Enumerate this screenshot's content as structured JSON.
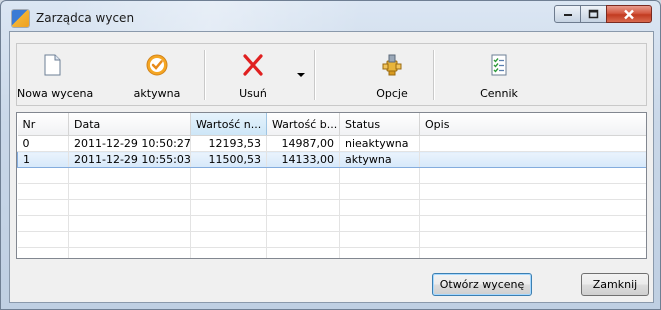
{
  "window": {
    "title": "Zarządca wycen"
  },
  "toolbar": {
    "new_label": "Nowa wycena",
    "active_label": "aktywna",
    "delete_label": "Usuń",
    "options_label": "Opcje",
    "pricelist_label": "Cennik"
  },
  "grid": {
    "columns": [
      "Nr",
      "Data",
      "Wartość n...",
      "Wartość b...",
      "Status",
      "Opis"
    ],
    "rows": [
      {
        "nr": "0",
        "data": "2011-12-29 10:50:27",
        "wartosc_n": "12193,53",
        "wartosc_b": "14987,00",
        "status": "nieaktywna",
        "opis": ""
      },
      {
        "nr": "1",
        "data": "2011-12-29 10:55:03",
        "wartosc_n": "11500,53",
        "wartosc_b": "14133,00",
        "status": "aktywna",
        "opis": ""
      }
    ],
    "selected_row": 1
  },
  "footer": {
    "open_label": "Otwórz wycenę",
    "close_label": "Zamknij"
  },
  "icons": {
    "new": "document-icon",
    "active": "checkmark-circle-icon",
    "delete": "red-x-icon",
    "options": "gear-plugin-icon",
    "pricelist": "checklist-icon"
  },
  "colors": {
    "selection": "#d6e8fa",
    "close_button": "#c23b21"
  }
}
